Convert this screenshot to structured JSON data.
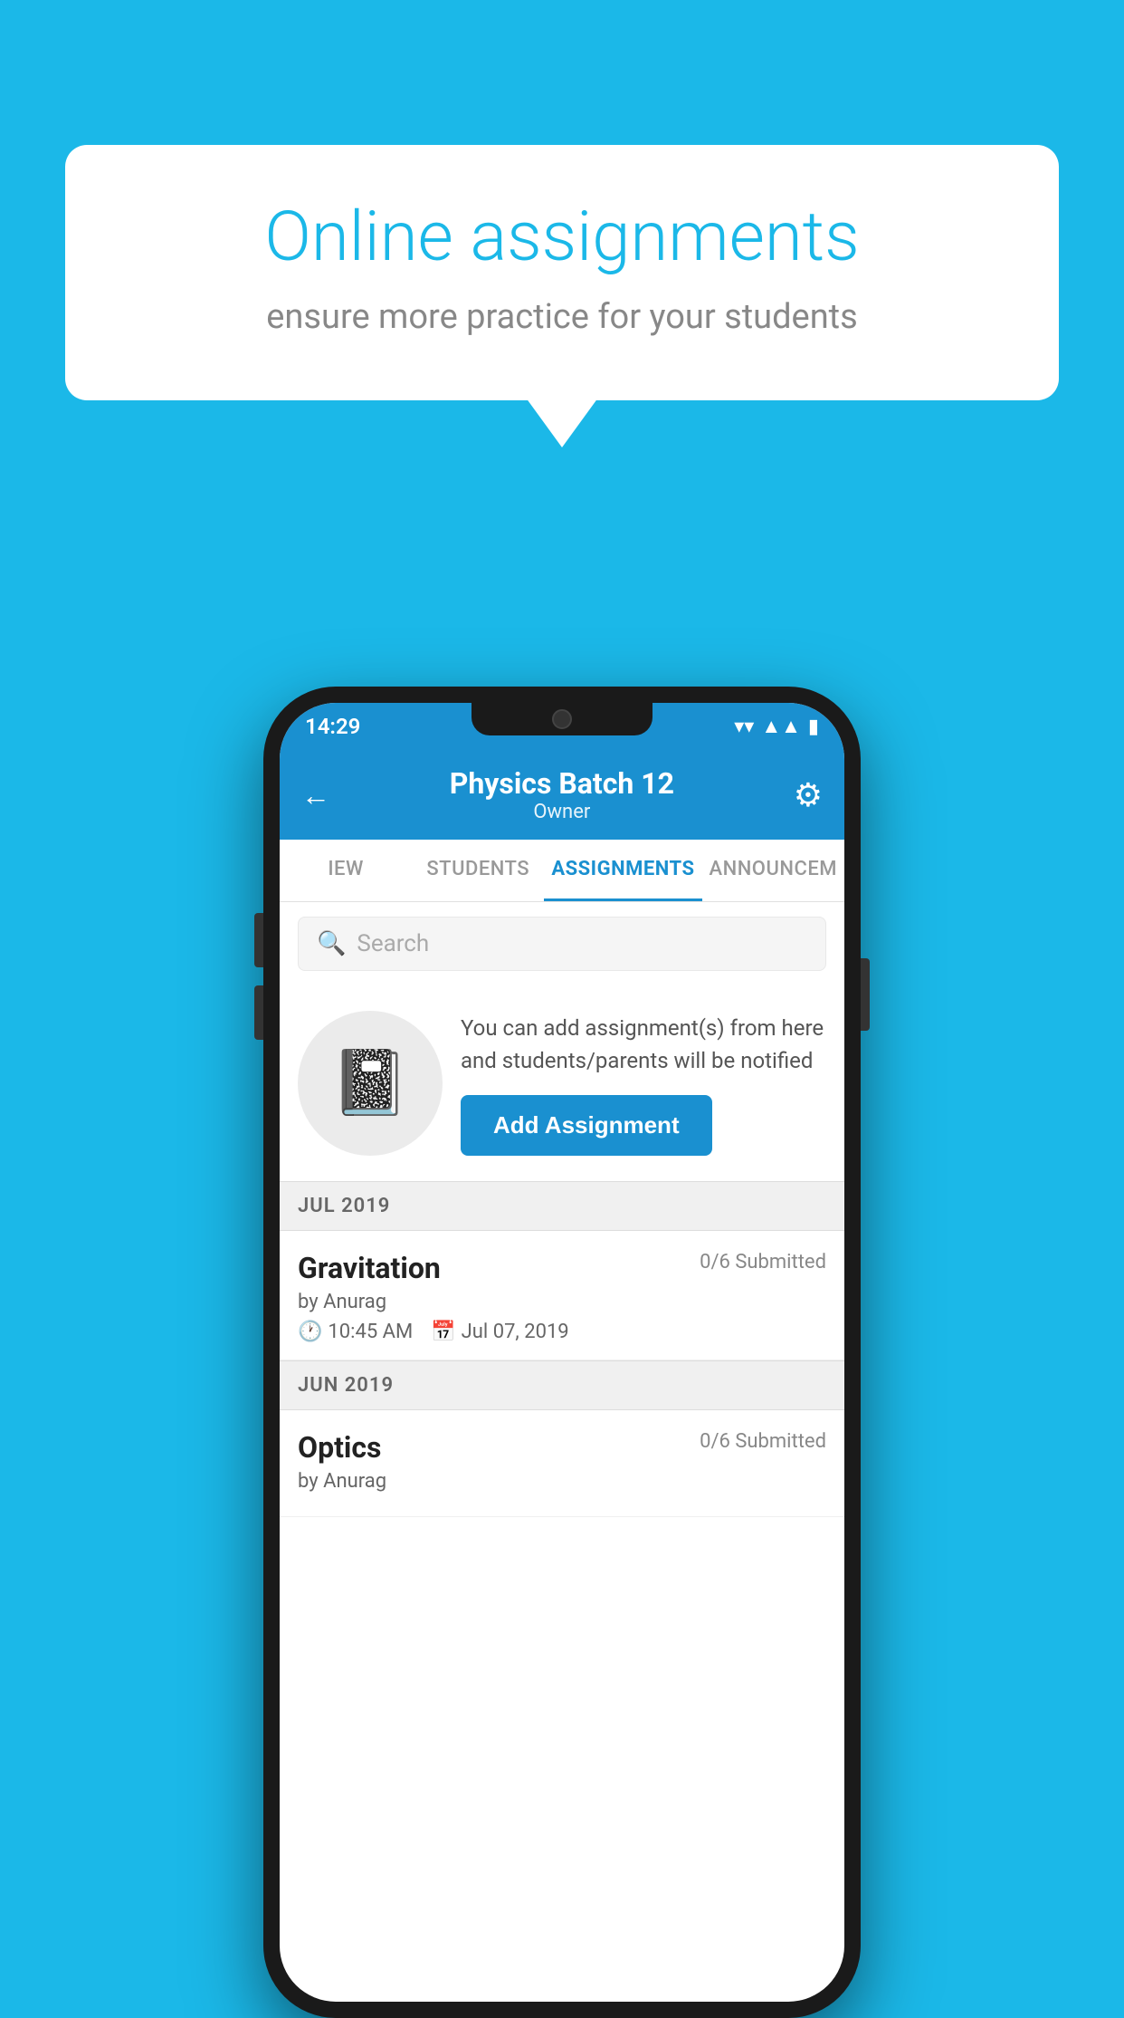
{
  "background_color": "#1bb8e8",
  "speech_bubble": {
    "title": "Online assignments",
    "subtitle": "ensure more practice for your students"
  },
  "status_bar": {
    "time": "14:29",
    "icons": [
      "wifi",
      "signal",
      "battery"
    ]
  },
  "header": {
    "title": "Physics Batch 12",
    "subtitle": "Owner",
    "back_label": "←",
    "settings_label": "⚙"
  },
  "tabs": [
    {
      "label": "IEW",
      "active": false
    },
    {
      "label": "STUDENTS",
      "active": false
    },
    {
      "label": "ASSIGNMENTS",
      "active": true
    },
    {
      "label": "ANNOUNCEM",
      "active": false
    }
  ],
  "search": {
    "placeholder": "Search"
  },
  "promo": {
    "description": "You can add assignment(s) from here and students/parents will be notified",
    "button_label": "Add Assignment"
  },
  "sections": [
    {
      "header": "JUL 2019",
      "assignments": [
        {
          "name": "Gravitation",
          "submitted": "0/6 Submitted",
          "by": "by Anurag",
          "time": "10:45 AM",
          "date": "Jul 07, 2019"
        }
      ]
    },
    {
      "header": "JUN 2019",
      "assignments": [
        {
          "name": "Optics",
          "submitted": "0/6 Submitted",
          "by": "by Anurag",
          "time": "",
          "date": ""
        }
      ]
    }
  ]
}
